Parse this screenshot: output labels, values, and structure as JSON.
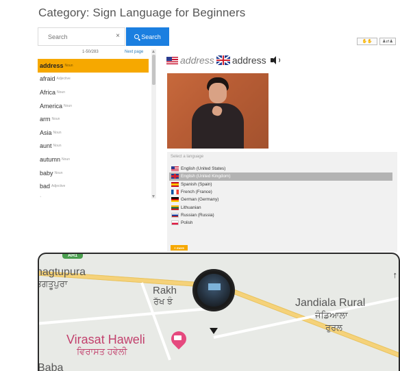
{
  "page": {
    "title": "Category: Sign Language for Beginners"
  },
  "search": {
    "placeholder": "Search",
    "clear_symbol": "×",
    "button_label": "Search"
  },
  "toolbar": {
    "icon_1": "spread-hands-icon",
    "icon_2": "people-icon"
  },
  "word_list": {
    "range": "1-50/283",
    "next_label": "Next page",
    "items": [
      {
        "word": "address",
        "pos": "Noun"
      },
      {
        "word": "afraid",
        "pos": "Adjective"
      },
      {
        "word": "Africa",
        "pos": "Noun"
      },
      {
        "word": "America",
        "pos": "Noun"
      },
      {
        "word": "arm",
        "pos": "Noun"
      },
      {
        "word": "Asia",
        "pos": "Noun"
      },
      {
        "word": "aunt",
        "pos": "Noun"
      },
      {
        "word": "autumn",
        "pos": "Noun"
      },
      {
        "word": "baby",
        "pos": "Noun"
      },
      {
        "word": "bad",
        "pos": "Adjective"
      }
    ],
    "selected_index": 0
  },
  "detail": {
    "word_us": "address",
    "word_uk": "address",
    "speaker_icon": "speaker-icon"
  },
  "languages": {
    "label": "Select a language",
    "items": [
      {
        "name": "English (United States)",
        "flag": "us"
      },
      {
        "name": "English (United Kingdom)",
        "flag": "uk"
      },
      {
        "name": "Spanish (Spain)",
        "flag": "es"
      },
      {
        "name": "French (France)",
        "flag": "fr"
      },
      {
        "name": "German (Germany)",
        "flag": "de"
      },
      {
        "name": "Lithuanian",
        "flag": "lt"
      },
      {
        "name": "Russian (Russia)",
        "flag": "ru"
      },
      {
        "name": "Polish",
        "flag": "pl"
      }
    ],
    "selected_index": 1,
    "more_label": "+ more"
  },
  "map": {
    "labels": {
      "nagtupura": "nagtupura",
      "nagtupura_punjabi": "ਭਗਤੂਪੁਰਾ",
      "rakh": "Rakh",
      "rakh_punjabi": "ਰੱਖ ਝੰ",
      "jandiala": "Jandiala Rural",
      "jandiala_punjabi_1": "ਜੰਡਿਆਲਾ",
      "jandiala_punjabi_2": "ਰੁਰਲ",
      "virasat": "Virasat Haweli",
      "virasat_punjabi": "ਵਿਰਾਸਤ ਹਵੇਲੀ",
      "baba": "Baba",
      "highway": "AH1"
    }
  }
}
